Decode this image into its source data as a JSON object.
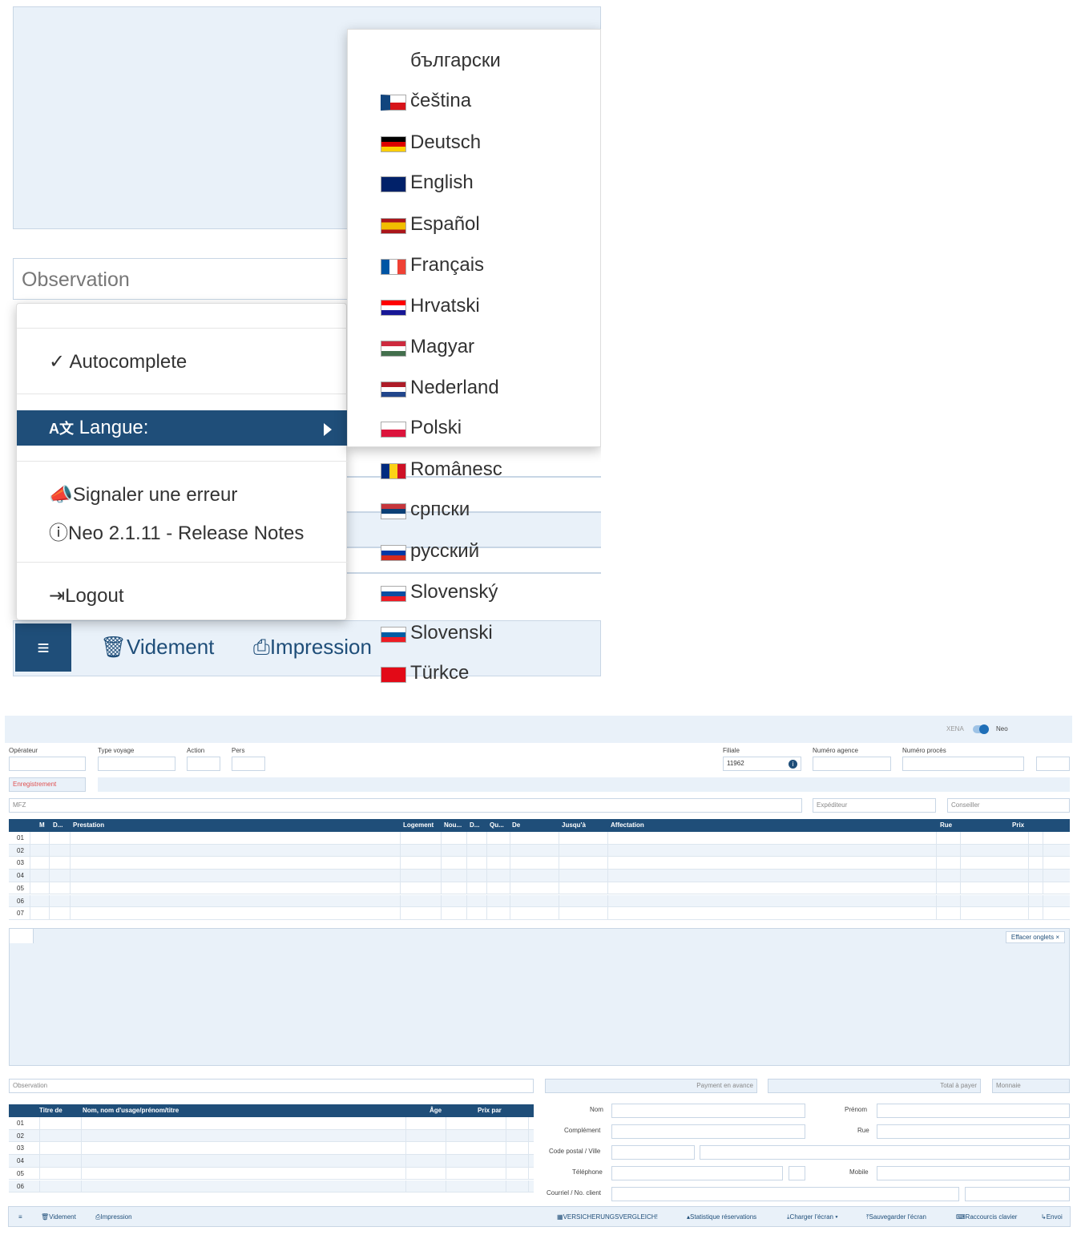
{
  "zoom": {
    "observation_placeholder": "Observation",
    "menu": {
      "autocomplete": "✓ Autocomplete",
      "langue": "Langue:",
      "signaler": "Signaler une erreur",
      "release_notes": "Neo 2.1.11 - Release Notes",
      "logout": "Logout"
    },
    "languages": [
      "български",
      "čeština",
      "Deutsch",
      "English",
      "Español",
      "Français",
      "Hrvatski",
      "Magyar",
      "Nederland",
      "Polski",
      "Românesc",
      "српски",
      "русский",
      "Slovenský",
      "Slovenski",
      "Türkce"
    ],
    "bar": {
      "hamburger": "≡",
      "videment": "Videment",
      "impression": "Impression"
    }
  },
  "app": {
    "toggle": {
      "left": "XENA",
      "right": "Neo"
    },
    "labels": {
      "operateur": "Opérateur",
      "type_voyage": "Type voyage",
      "action": "Action",
      "pers": "Pers",
      "filiale": "Filiale",
      "numero_agence": "Numéro agence",
      "numero_proces": "Numéro procès"
    },
    "filiale_value": "11962",
    "enregistrement": "Enregistrement",
    "mfz": "MFZ",
    "expediteur": "Expéditeur",
    "conseiller": "Conseiller",
    "table1": {
      "headers": [
        "M",
        "D...",
        "Prestation",
        "Logement",
        "Nou...",
        "D...",
        "Qu...",
        "De",
        "Jusqu'à",
        "Affectation",
        "Rue",
        "Prix"
      ],
      "rows": [
        "01",
        "02",
        "03",
        "04",
        "05",
        "06",
        "07"
      ]
    },
    "effacer": "Effacer onglets ×",
    "observation": "Observation",
    "payment": "Payment en avance",
    "total": "Total à payer",
    "monnaie": "Monnaie",
    "table2": {
      "headers": [
        "Titre de",
        "Nom, nom d'usage/prénom/titre",
        "Âge",
        "Prix par"
      ],
      "rows": [
        "01",
        "02",
        "03",
        "04",
        "05",
        "06"
      ]
    },
    "form": {
      "nom": "Nom",
      "prenom": "Prénom",
      "complement": "Complément",
      "rue": "Rue",
      "code_postal": "Code postal / Ville",
      "telephone": "Téléphone",
      "mobile": "Mobile",
      "courriel": "Courriel / No. client"
    },
    "toolbar": {
      "hamburger": "≡",
      "videment": "Videment",
      "impression": "Impression",
      "versicherung": "VERSICHERUNGSVERGLEICH!",
      "statistique": "Statistique réservations",
      "charger": "Charger l'écran ▾",
      "sauvegarder": "Sauvegarder l'écran",
      "raccourcis": "Raccourcis clavier",
      "envoi": "Envoi"
    }
  }
}
